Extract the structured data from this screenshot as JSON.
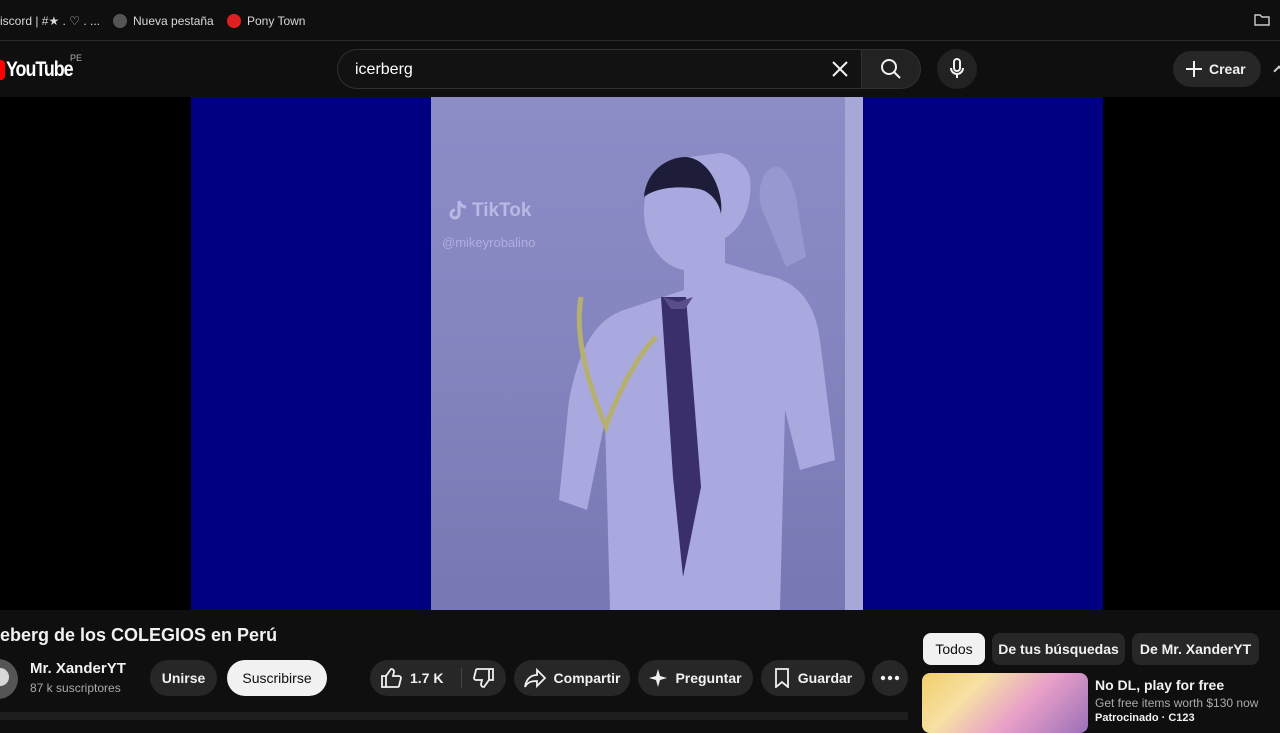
{
  "bookmarks": {
    "items": [
      {
        "label": "iscord | #★ . ♡ . ..."
      },
      {
        "label": "Nueva pestaña"
      },
      {
        "label": "Pony Town"
      }
    ]
  },
  "masthead": {
    "logo_text": "YouTube",
    "country_code": "PE",
    "search_value": "icerberg",
    "create_label": "Crear"
  },
  "player": {
    "watermark_brand": "TikTok",
    "watermark_handle": "@mikeyrobalino"
  },
  "video": {
    "title": "eberg de los COLEGIOS en Perú",
    "channel_name": "Mr. XanderYT",
    "subscribers": "87 k suscriptores",
    "join_label": "Unirse",
    "subscribe_label": "Suscribirse",
    "like_count": "1.7 K",
    "share_label": "Compartir",
    "ask_label": "Preguntar",
    "save_label": "Guardar"
  },
  "chips": [
    {
      "label": "Todos"
    },
    {
      "label": "De tus búsquedas"
    },
    {
      "label": "De Mr. XanderYT"
    }
  ],
  "suggestion": {
    "title": "No DL, play for free",
    "description": "Get free items worth $130 now",
    "sponsored": "Patrocinado · C123"
  },
  "colors": {
    "background": "#0f0f0f",
    "brand_red": "#ff0000",
    "video_frame": "#000080"
  }
}
